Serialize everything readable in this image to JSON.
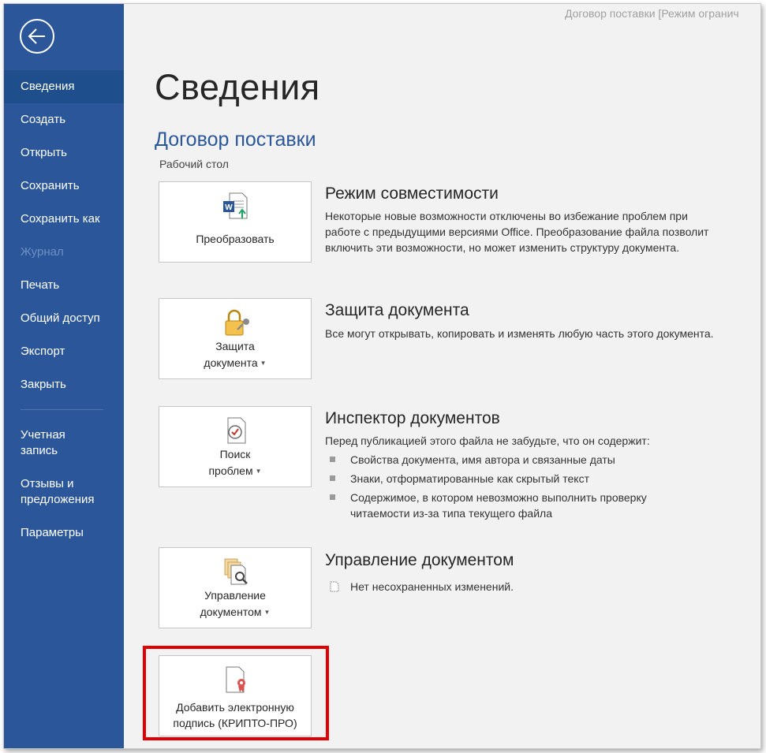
{
  "window": {
    "title": "Договор поставки [Режим огранич"
  },
  "sidebar": {
    "back_icon": "back-arrow-icon",
    "items": [
      {
        "label": "Сведения"
      },
      {
        "label": "Создать"
      },
      {
        "label": "Открыть"
      },
      {
        "label": "Сохранить"
      },
      {
        "label": "Сохранить как"
      },
      {
        "label": "Журнал"
      },
      {
        "label": "Печать"
      },
      {
        "label": "Общий доступ"
      },
      {
        "label": "Экспорт"
      },
      {
        "label": "Закрыть"
      },
      {
        "label_line1": "Учетная",
        "label_line2": "запись"
      },
      {
        "label_line1": "Отзывы и",
        "label_line2": "предложения"
      },
      {
        "label": "Параметры"
      }
    ],
    "active_item": "Сведения",
    "disabled_item": "Журнал"
  },
  "main": {
    "page_title": "Сведения",
    "document_name": "Договор поставки",
    "document_location": "Рабочий стол",
    "sections": [
      {
        "button": {
          "line1": "Преобразовать",
          "icon": "word-convert-icon"
        },
        "title": "Режим совместимости",
        "text": "Некоторые новые возможности отключены во избежание проблем при работе с предыдущими версиями Office. Преобразование файла позволит включить эти возможности, но может изменить структуру документа."
      },
      {
        "button": {
          "line1": "Защита",
          "line2": "документа",
          "icon": "lock-key-icon"
        },
        "title": "Защита документа",
        "text": "Все могут открывать, копировать и изменять любую часть этого документа."
      },
      {
        "button": {
          "line1": "Поиск",
          "line2": "проблем",
          "icon": "document-check-icon"
        },
        "title": "Инспектор документов",
        "text": "Перед публикацией этого файла не забудьте, что он содержит:",
        "bullets": [
          "Свойства документа, имя автора и связанные даты",
          "Знаки, отформатированные как скрытый текст",
          "Содержимое, в котором невозможно выполнить проверку читаемости из-за типа текущего файла"
        ]
      },
      {
        "button": {
          "line1": "Управление",
          "line2": "документом",
          "icon": "documents-search-icon"
        },
        "title": "Управление документом",
        "status_icon": "document-small-icon",
        "text": "Нет несохраненных изменений."
      },
      {
        "button": {
          "line1": "Добавить электронную",
          "line2": "подпись (КРИПТО-ПРО)",
          "icon": "document-ribbon-icon"
        }
      }
    ]
  },
  "colors": {
    "sidebar": "#2b579a",
    "sidebar_active": "#1e4e8c",
    "accent_text": "#2b579a",
    "highlight_frame": "#e00000",
    "background": "#f2f2f2"
  }
}
